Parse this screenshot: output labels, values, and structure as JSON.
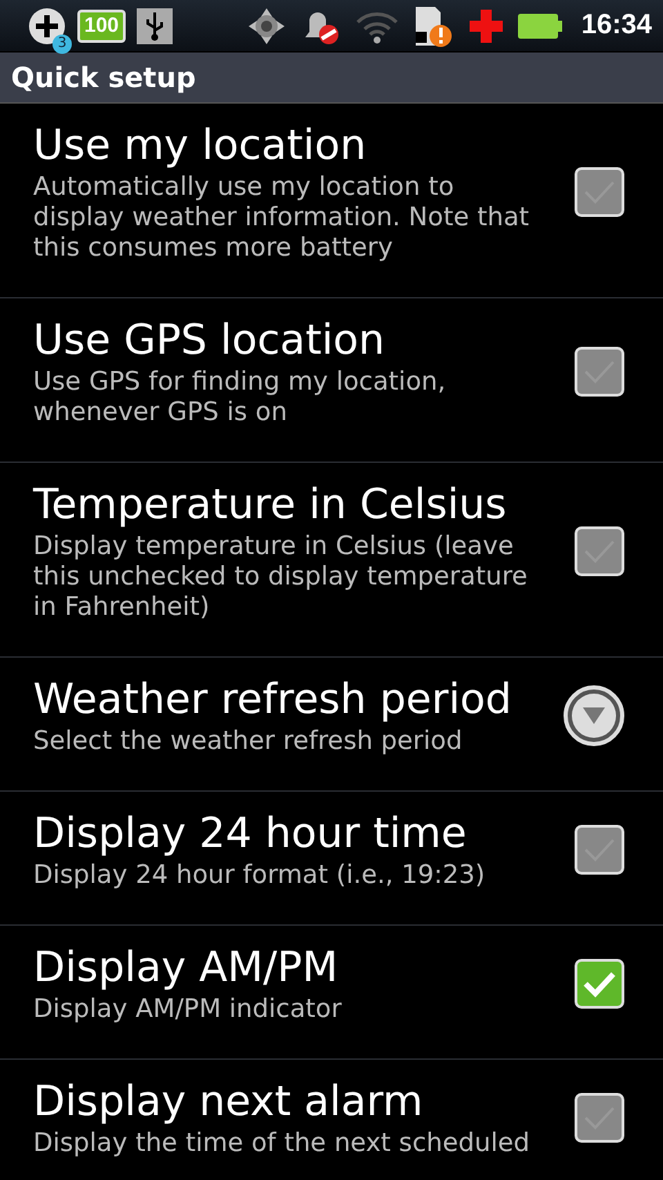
{
  "status_bar": {
    "notification_count": "3",
    "battery_label": "100",
    "time": "16:34"
  },
  "title_bar": {
    "title": "Quick setup"
  },
  "preferences": [
    {
      "kind": "checkbox",
      "title": "Use my location",
      "summary": "Automatically use my location to display weather information. Note that this consumes more battery",
      "checked": false
    },
    {
      "kind": "checkbox",
      "title": "Use GPS location",
      "summary": "Use GPS for finding my location, whenever GPS is on",
      "checked": false
    },
    {
      "kind": "checkbox",
      "title": "Temperature in Celsius",
      "summary": "Display temperature in Celsius (leave this unchecked to display temperature in Fahrenheit)",
      "checked": false
    },
    {
      "kind": "list",
      "title": "Weather refresh period",
      "summary": "Select the weather refresh period"
    },
    {
      "kind": "checkbox",
      "title": "Display 24 hour time",
      "summary": "Display 24 hour format (i.e., 19:23)",
      "checked": false
    },
    {
      "kind": "checkbox",
      "title": "Display AM/PM",
      "summary": "Display AM/PM indicator",
      "checked": true
    },
    {
      "kind": "checkbox",
      "title": "Display next alarm",
      "summary": "Display the time of the next scheduled",
      "checked": false
    }
  ]
}
